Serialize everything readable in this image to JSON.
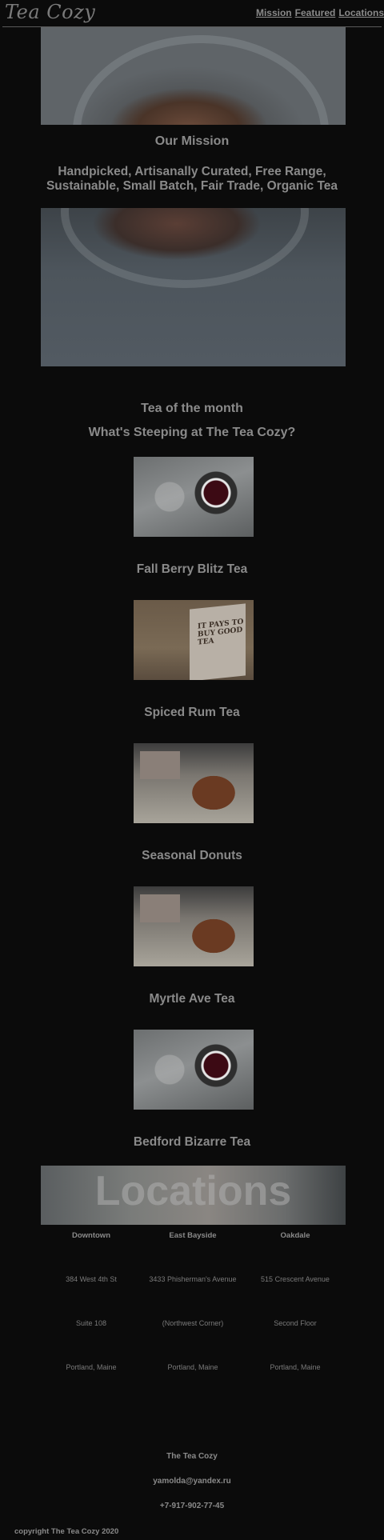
{
  "header": {
    "logo": "Tea Cozy",
    "nav": [
      "Mission",
      "Featured",
      "Locations"
    ]
  },
  "mission": {
    "title": "Our Mission",
    "text": "Handpicked, Artisanally Curated, Free Range, Sustainable, Small Batch, Fair Trade, Organic Tea"
  },
  "featured": {
    "month_title": "Tea of the month",
    "steeping_title": "What's Steeping at The Tea Cozy?",
    "items": [
      {
        "name": "Fall Berry Blitz Tea"
      },
      {
        "name": "Spiced Rum Tea"
      },
      {
        "name": "Seasonal Donuts"
      },
      {
        "name": "Myrtle Ave Tea"
      },
      {
        "name": "Bedford Bizarre Tea"
      }
    ]
  },
  "box_text": "IT PAYS TO BUY GOOD TEA",
  "locations": {
    "banner": "Locations",
    "places": [
      {
        "name": "Downtown",
        "address": "384 West 4th St",
        "detail": "Suite 108",
        "city": "Portland, Maine"
      },
      {
        "name": "East Bayside",
        "address": "3433 Phisherman's Avenue",
        "detail": "(Northwest Corner)",
        "city": "Portland, Maine"
      },
      {
        "name": "Oakdale",
        "address": "515 Crescent Avenue",
        "detail": "Second Floor",
        "city": "Portland, Maine"
      }
    ]
  },
  "footer": {
    "name": "The Tea Cozy",
    "email": "yamolda@yandex.ru",
    "phone": "+7-917-902-77-45",
    "copyright": "copyright The Tea Cozy 2020"
  }
}
